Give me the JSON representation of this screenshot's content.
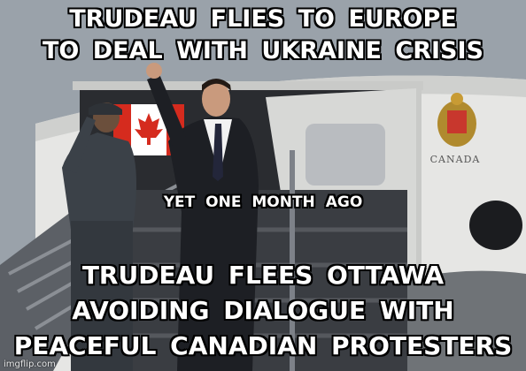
{
  "meme": {
    "top_caption": [
      "TRUDEAU  FLIES  TO  EUROPE",
      "TO  DEAL  WITH  UKRAINE  CRISIS"
    ],
    "middle_caption": "YET  ONE  MONTH  AGO",
    "bottom_caption": [
      "TRUDEAU  FLEES  OTTAWA",
      "AVOIDING  DIALOGUE  WITH",
      "PEACEFUL  CANADIAN  PROTESTERS"
    ],
    "watermark": "imgflip.com"
  },
  "photo": {
    "plane_text": "CANADA",
    "colors": {
      "sky": "#9aa2aa",
      "fuselage": "#e6e6e4",
      "flag_red": "#d52b1e",
      "suit": "#1d1f24",
      "uniform": "#3b4148"
    }
  }
}
